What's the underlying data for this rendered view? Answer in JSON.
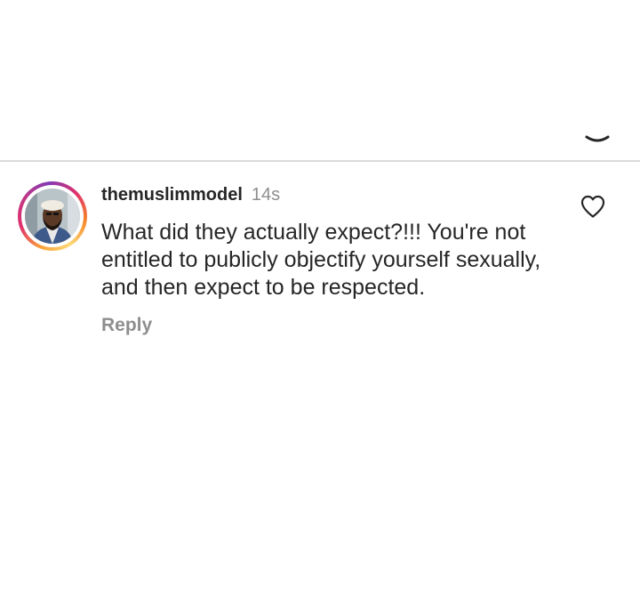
{
  "comment": {
    "username": "themuslimmodel",
    "timestamp": "14s",
    "text": "What did they actually expect?!!! You're not entitled to publicly objectify yourself sexually, and then expect to be respected.",
    "reply_label": "Reply"
  },
  "icons": {
    "like": "heart-outline-icon",
    "handle": "sheet-handle-icon"
  },
  "colors": {
    "text": "#262626",
    "secondary_text": "#8e8e8e",
    "divider": "#dbdbdb",
    "story_ring_start": "#f9a23a",
    "story_ring_end": "#c13584"
  }
}
